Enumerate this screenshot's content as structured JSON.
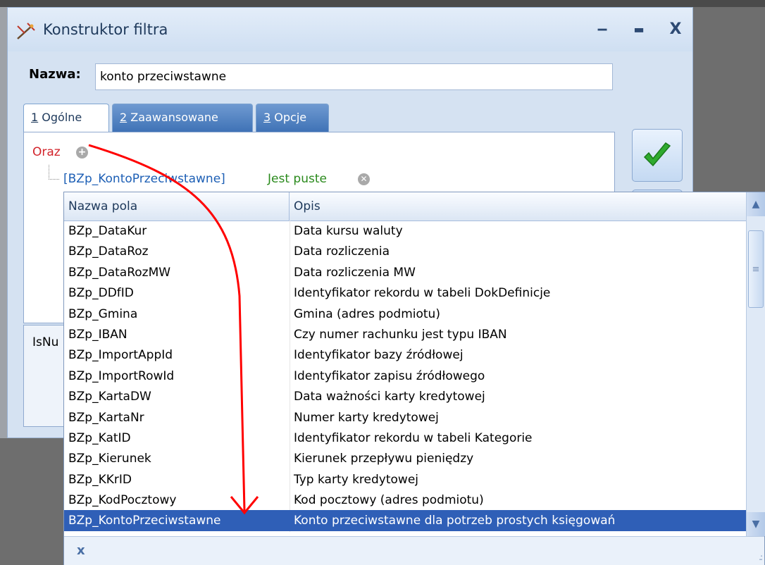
{
  "window": {
    "title": "Konstruktor filtra",
    "minimize": "‒",
    "maximize": "▬",
    "close": "X"
  },
  "name_field": {
    "label": "Nazwa:",
    "value": "konto przeciwstawne"
  },
  "tabs": [
    {
      "num": "1",
      "label": " Ogólne",
      "active": true
    },
    {
      "num": "2",
      "label": " Zaawansowane",
      "active": false
    },
    {
      "num": "3",
      "label": " Opcje",
      "active": false
    }
  ],
  "condition": {
    "group_operator": "Oraz",
    "field": "[BZp_KontoPrzeciwstawne]",
    "operator": "Jest puste"
  },
  "description_panel": {
    "text": "IsNu"
  },
  "dropdown": {
    "columns": [
      "Nazwa pola",
      "Opis"
    ],
    "rows": [
      [
        "BZp_DataKur",
        "Data kursu waluty"
      ],
      [
        "BZp_DataRoz",
        "Data rozliczenia"
      ],
      [
        "BZp_DataRozMW",
        "Data rozliczenia MW"
      ],
      [
        "BZp_DDfID",
        "Identyfikator rekordu w tabeli DokDefinicje"
      ],
      [
        "BZp_Gmina",
        "Gmina (adres podmiotu)"
      ],
      [
        "BZp_IBAN",
        "Czy numer rachunku jest typu IBAN"
      ],
      [
        "BZp_ImportAppId",
        "Identyfikator bazy źródłowej"
      ],
      [
        "BZp_ImportRowId",
        "Identyfikator zapisu źródłowego"
      ],
      [
        "BZp_KartaDW",
        "Data ważności karty kredytowej"
      ],
      [
        "BZp_KartaNr",
        "Numer karty kredytowej"
      ],
      [
        "BZp_KatID",
        "Identyfikator rekordu w tabeli Kategorie"
      ],
      [
        "BZp_Kierunek",
        "Kierunek przepływu pieniędzy"
      ],
      [
        "BZp_KKrID",
        "Typ karty kredytowej"
      ],
      [
        "BZp_KodPocztowy",
        "Kod pocztowy (adres podmiotu)"
      ],
      [
        "BZp_KontoPrzeciwstawne",
        "Konto przeciwstawne dla potrzeb prostych księgowań"
      ]
    ],
    "selected_index": 14,
    "footer_close": "x"
  },
  "colors": {
    "selection": "#2f5fb7",
    "group_operator": "#d2232a",
    "field": "#1d5fb5",
    "operator": "#2a8a1c",
    "annotation_arrow": "#ff0000"
  }
}
